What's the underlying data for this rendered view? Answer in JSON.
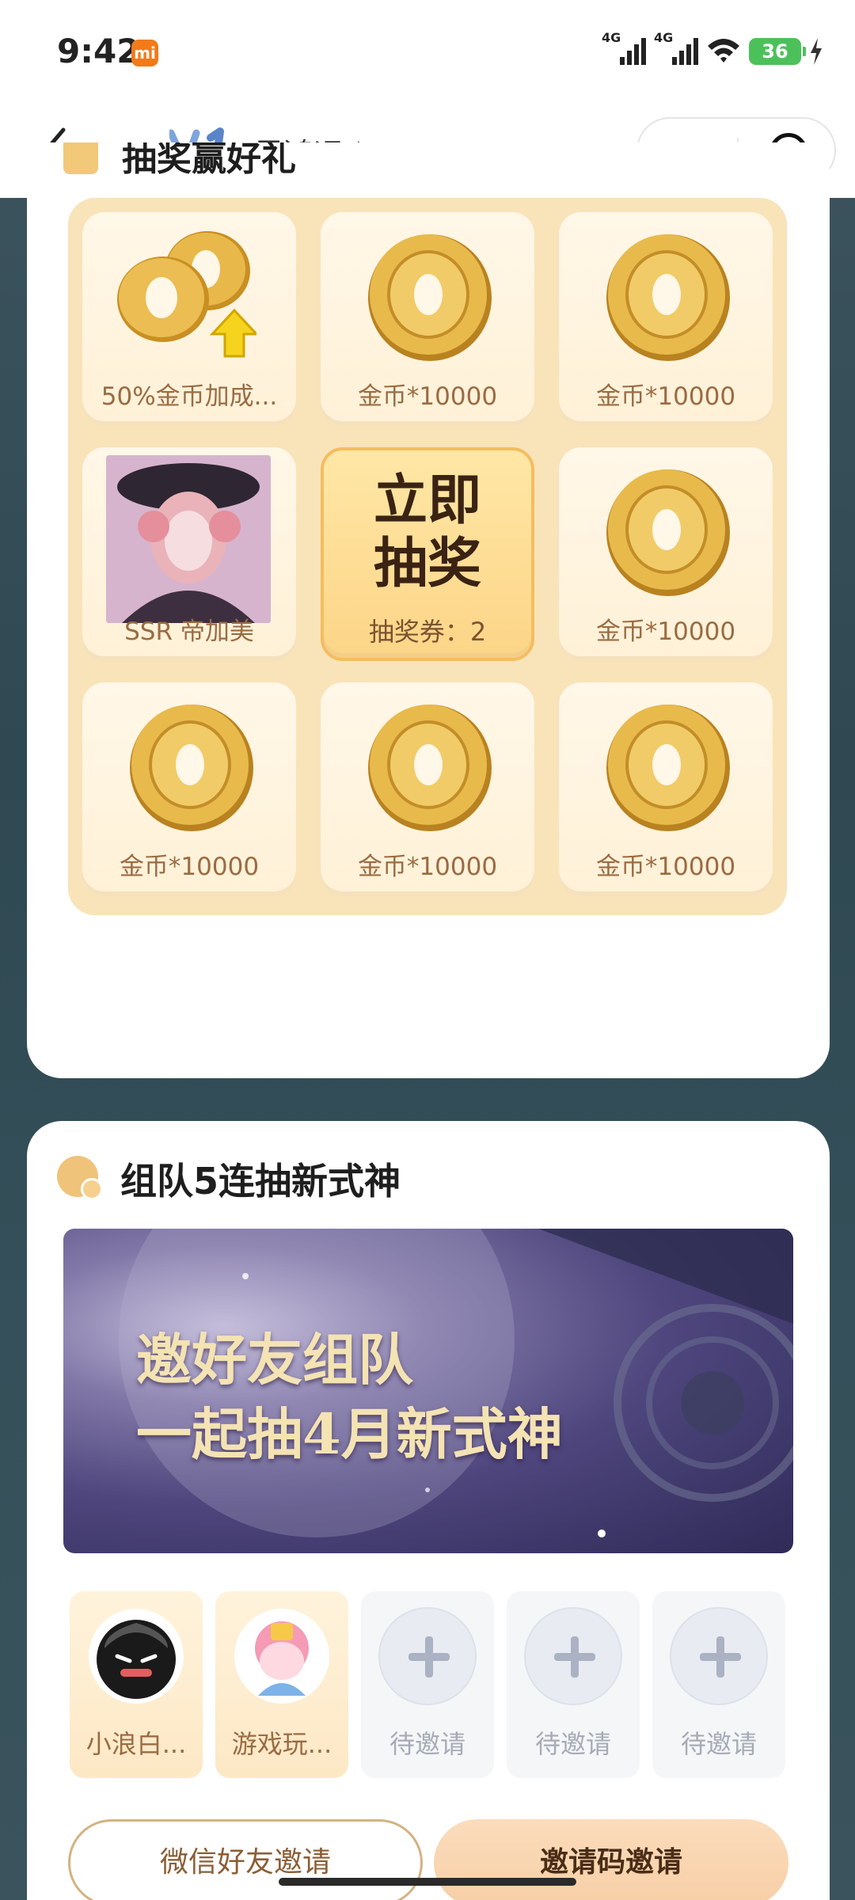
{
  "status_bar": {
    "time": "9:42",
    "mi_badge": "mi",
    "net1": "4G",
    "net2": "4G",
    "battery": "36"
  },
  "nav": {
    "logo_text": "V1",
    "title": "馬鸿运"
  },
  "lottery": {
    "title": "抽奖赢好礼",
    "cells": [
      {
        "label": "50%金币加成..."
      },
      {
        "label": "金币*10000"
      },
      {
        "label": "金币*10000"
      },
      {
        "label": "SSR 帝加美"
      },
      {
        "label": "金币*10000"
      },
      {
        "label": "金币*10000"
      },
      {
        "label": "金币*10000"
      },
      {
        "label": "金币*10000"
      }
    ],
    "draw_button": {
      "line1": "立即",
      "line2": "抽奖",
      "ticket_text": "抽奖券：2"
    }
  },
  "team": {
    "title": "组队5连抽新式神",
    "banner_line1": "邀好友组队",
    "banner_line2": "一起抽4月新式神",
    "slots": [
      {
        "label": "小浪白..."
      },
      {
        "label": "游戏玩..."
      },
      {
        "label": "待邀请"
      },
      {
        "label": "待邀请"
      },
      {
        "label": "待邀请"
      }
    ],
    "btn_wechat": "微信好友邀请",
    "btn_code": "邀请码邀请"
  },
  "colors": {
    "accent_gold": "#f4bd5f",
    "label_brown": "#9b6b42",
    "card_bg": "#ffffff",
    "page_bg": "#35505a"
  }
}
